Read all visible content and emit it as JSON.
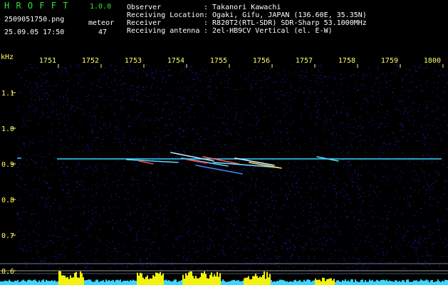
{
  "header": {
    "brand": "H R O F F T",
    "version": "1.0.0",
    "filename": "2509051750.png",
    "datetime": "25.09.05 17:50",
    "meteor_label": "meteor",
    "meteor_count": "47"
  },
  "info": [
    {
      "key": "Observer",
      "value": ": Takanori Kawachi"
    },
    {
      "key": "Receiving Location",
      "value": ": Ogaki, Gifu, JAPAN (136.60E, 35.35N)"
    },
    {
      "key": "Receiver",
      "value": ": R820T2(RTL-SDR) SDR-Sharp 53.1000MHz"
    },
    {
      "key": "Receiving antenna",
      "value": ": 2el-HB9CV Vertical (el. E-W)"
    }
  ],
  "colors": {
    "brand": "#36e336",
    "text": "#ffffff",
    "axis_label": "#ffff66",
    "background": "#000000",
    "noise": "#0a0a70",
    "carrier": "#39d6ff",
    "signal_bar": "#f2f20a",
    "baseline_bar": "#39d6ff"
  },
  "chart_data": {
    "type": "heatmap",
    "x": {
      "unit": "minute",
      "ticks": [
        "1751",
        "1752",
        "1753",
        "1754",
        "1755",
        "1756",
        "1757",
        "1758",
        "1759",
        "1800"
      ],
      "range": [
        "1750",
        "1800"
      ]
    },
    "y": {
      "unit": "kHz",
      "ticks": [
        "1.1",
        "1.0",
        "0.9",
        "0.8",
        "0.7",
        "0.6"
      ],
      "range": [
        0.6,
        1.1
      ]
    },
    "carrier_khz": 0.91
  }
}
